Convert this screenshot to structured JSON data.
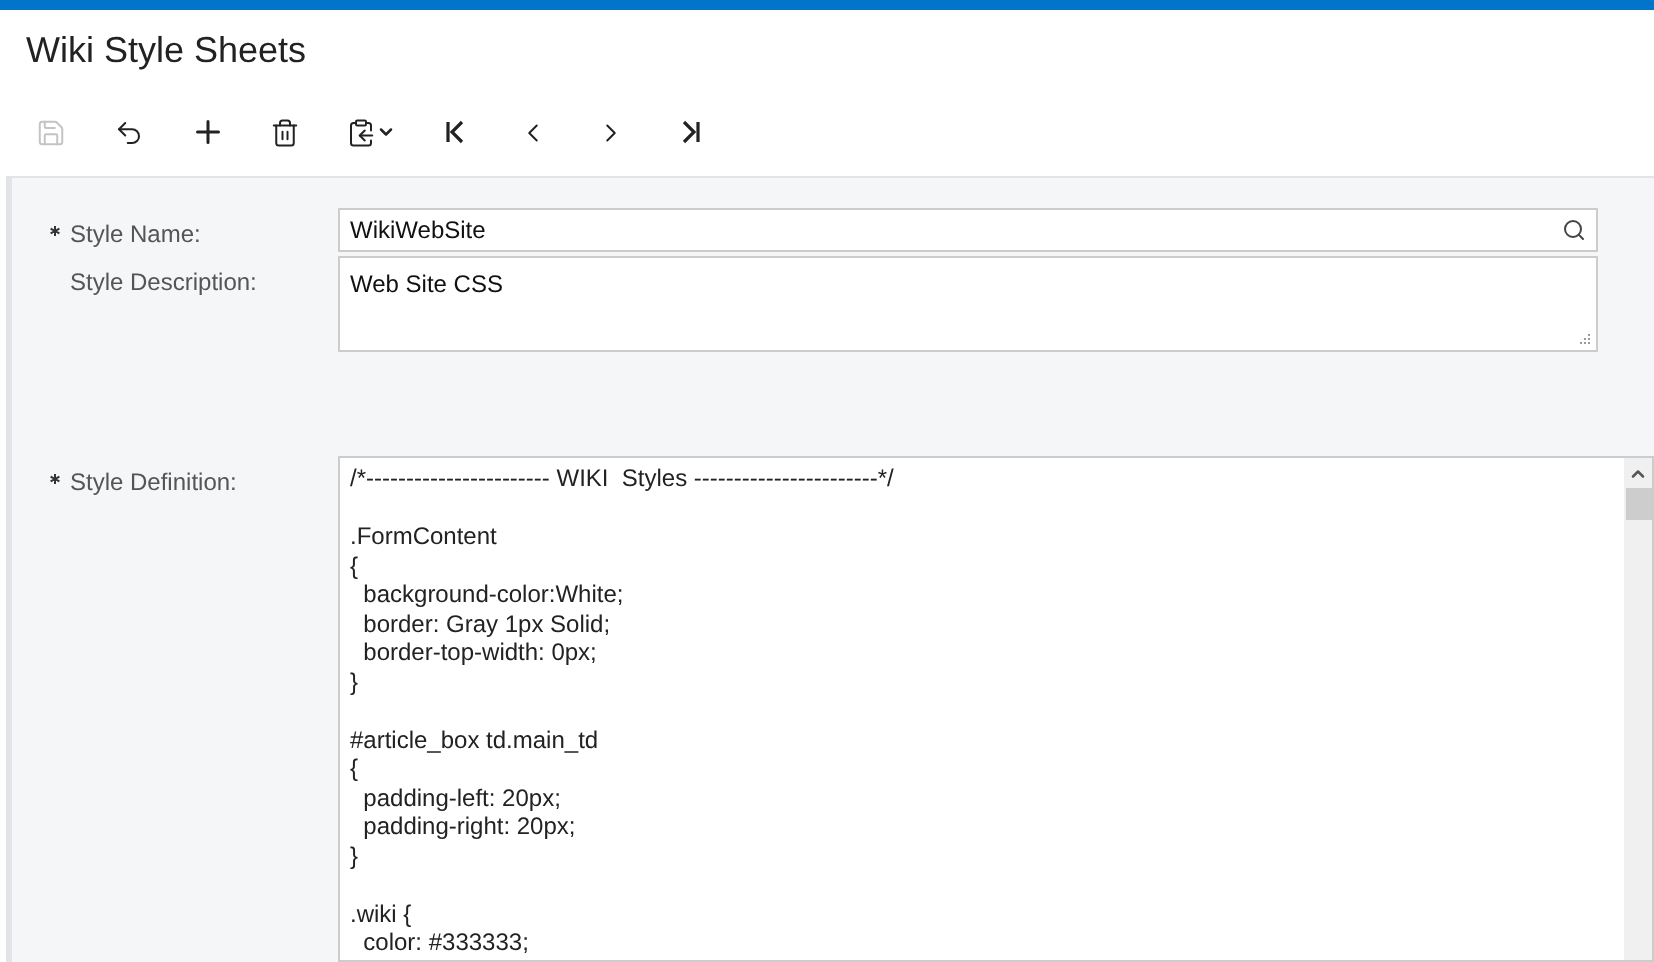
{
  "window": {
    "title": "Wiki Style Sheets"
  },
  "toolbar": [
    {
      "kind": "save",
      "disabled": true
    },
    {
      "kind": "undo",
      "disabled": false
    },
    {
      "kind": "add",
      "disabled": false
    },
    {
      "kind": "delete",
      "disabled": false
    },
    {
      "kind": "copy",
      "disabled": false
    },
    {
      "kind": "first",
      "disabled": false
    },
    {
      "kind": "prev",
      "disabled": false
    },
    {
      "kind": "next",
      "disabled": false
    },
    {
      "kind": "last",
      "disabled": false
    }
  ],
  "form": {
    "style_name": {
      "label": "Style Name:",
      "required": true,
      "value": "WikiWebSite"
    },
    "style_description": {
      "label": "Style Description:",
      "required": false,
      "value": "Web Site CSS"
    },
    "style_definition": {
      "label": "Style Definition:",
      "required": true,
      "value": "/*----------------------- WIKI  Styles -----------------------*/\n\n.FormContent\n{\n  background-color:White;\n  border: Gray 1px Solid;\n  border-top-width: 0px;\n}\n\n#article_box td.main_td\n{\n  padding-left: 20px;\n  padding-right: 20px;\n}\n\n.wiki {\n  color: #333333;"
    }
  }
}
